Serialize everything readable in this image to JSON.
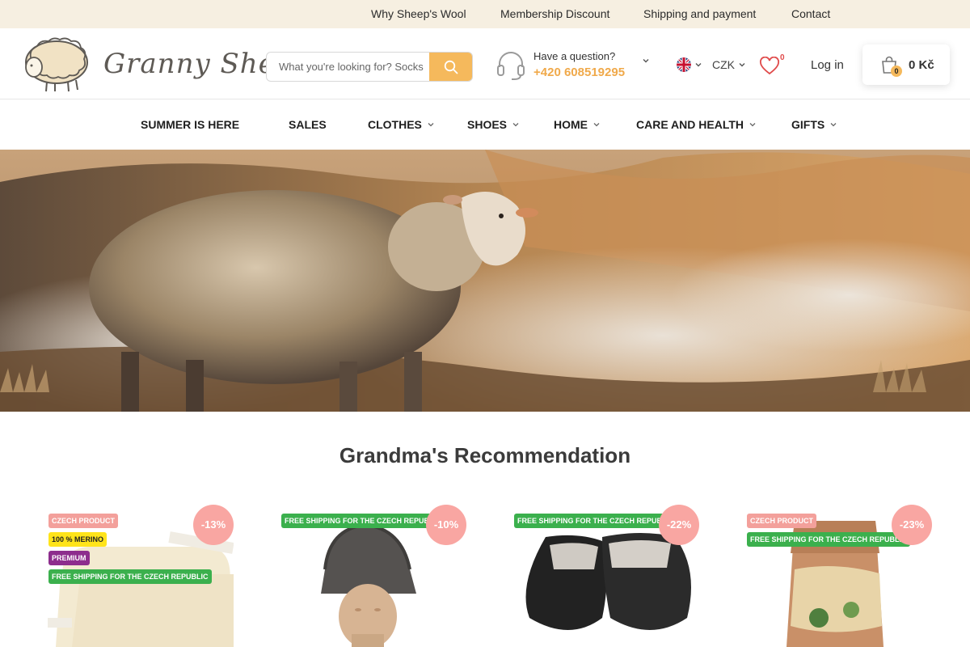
{
  "topbar": {
    "links": [
      "Why Sheep's Wool",
      "Membership Discount",
      "Shipping and payment",
      "Contact"
    ]
  },
  "header": {
    "logo_text": "Granny Sheep",
    "search_placeholder": "What you're looking for? Socks",
    "support_question": "Have a question?",
    "support_phone": "+420 608519295",
    "currency": "CZK",
    "wishlist_count": "0",
    "login_label": "Log in",
    "cart_count": "0",
    "cart_total": "0 Kč"
  },
  "nav": {
    "items": [
      {
        "label": "SUMMER IS HERE",
        "has_dropdown": false
      },
      {
        "label": "SALES",
        "has_dropdown": false
      },
      {
        "label": "CLOTHES",
        "has_dropdown": true
      },
      {
        "label": "SHOES",
        "has_dropdown": true
      },
      {
        "label": "HOME",
        "has_dropdown": true
      },
      {
        "label": "CARE AND HEALTH",
        "has_dropdown": true
      },
      {
        "label": "GIFTS",
        "has_dropdown": true
      }
    ]
  },
  "section": {
    "title": "Grandma's Recommendation"
  },
  "products": [
    {
      "discount": "-13%",
      "tags": [
        "CZECH PRODUCT",
        "100 % MERINO",
        "PREMIUM",
        "FREE SHIPPING FOR THE CZECH REPUBLIC"
      ]
    },
    {
      "discount": "-10%",
      "tags": [
        "FREE SHIPPING FOR THE CZECH REPUBLIC"
      ]
    },
    {
      "discount": "-22%",
      "tags": [
        "FREE SHIPPING FOR THE CZECH REPUBLIC"
      ]
    },
    {
      "discount": "-23%",
      "tags": [
        "CZECH PRODUCT",
        "FREE SHIPPING FOR THE CZECH REPUBLIC"
      ]
    }
  ],
  "colors": {
    "accent": "#f5b95c",
    "phone": "#f0a94a",
    "topbar_bg": "#f6efe1",
    "discount_bg": "#f9a6a2",
    "tag_ship": "#3bb04d",
    "tag_czech": "#f3a09b",
    "tag_merino": "#ffe41a",
    "tag_premium": "#8d2d8d"
  }
}
